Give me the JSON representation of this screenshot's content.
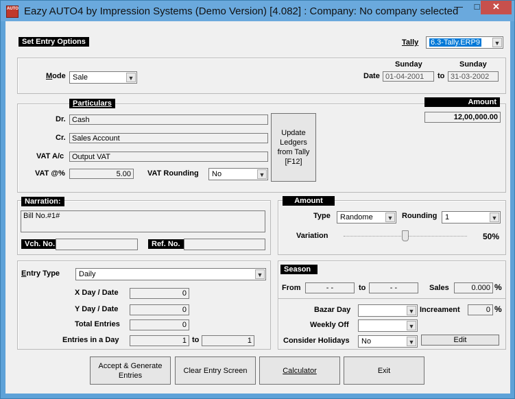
{
  "window": {
    "title": "Eazy AUTO4 by Impression Systems (Demo Version) [4.082] : Company: No company selected",
    "icon_text": "AUTO",
    "min_glyph": "—",
    "max_glyph": "□",
    "close_glyph": "✕"
  },
  "set_entry": {
    "header": "Set Entry Options",
    "tally_label": "Tally",
    "tally_value": "6.3-Tally.ERP9",
    "mode_label": "Mode",
    "mode_value": "Sale",
    "date_label": "Date",
    "from_day": "Sunday",
    "from_date": "01-04-2001",
    "to_label": "to",
    "to_day": "Sunday",
    "to_date": "31-03-2002"
  },
  "particulars": {
    "header": "Particulars",
    "dr_label": "Dr.",
    "dr_value": "Cash",
    "cr_label": "Cr.",
    "cr_value": "Sales Account",
    "vat_ac_label": "VAT A/c",
    "vat_ac_value": "Output VAT",
    "vat_pct_label": "VAT @%",
    "vat_pct_value": "5.00",
    "vat_rounding_label": "VAT Rounding",
    "vat_rounding_value": "No",
    "update_button": [
      "Update",
      "Ledgers",
      "from Tally",
      "[F12]"
    ],
    "amount_header": "Amount",
    "amount_value": "12,00,000.00"
  },
  "narration": {
    "header": "Narration:",
    "value": "Bill No.#1#",
    "vch_label": "Vch. No.",
    "vch_value": "",
    "ref_label": "Ref. No.",
    "ref_value": ""
  },
  "amount_opts": {
    "header": "Amount",
    "type_label": "Type",
    "type_value": "Randome",
    "rounding_label": "Rounding",
    "rounding_value": "1",
    "variation_label": "Variation",
    "variation_value": "50%",
    "variation_level": 0.5
  },
  "entry": {
    "entry_type_label": "Entry Type",
    "entry_type_value": "Daily",
    "x_day_label": "X Day / Date",
    "x_day_value": "0",
    "y_day_label": "Y Day / Date",
    "y_day_value": "0",
    "total_label": "Total Entries",
    "total_value": "0",
    "in_day_label": "Entries in a Day",
    "in_day_from": "1",
    "in_day_to_label": "to",
    "in_day_to": "1"
  },
  "season": {
    "header": "Season",
    "from_label": "From",
    "from_value": "- -",
    "to_label": "to",
    "to_value": "- -",
    "sales_label": "Sales",
    "sales_value": "0.000",
    "pct": "%",
    "bazar_label": "Bazar Day",
    "bazar_value": "",
    "increament_label": "Increament",
    "increament_value": "0",
    "weekly_label": "Weekly Off",
    "weekly_value": "",
    "holidays_label": "Consider Holidays",
    "holidays_value": "No",
    "edit_button": "Edit"
  },
  "buttons": {
    "accept": [
      "Accept & Generate",
      "Entries"
    ],
    "clear": "Clear Entry Screen",
    "calculator": "Calculator",
    "exit": "Exit"
  }
}
